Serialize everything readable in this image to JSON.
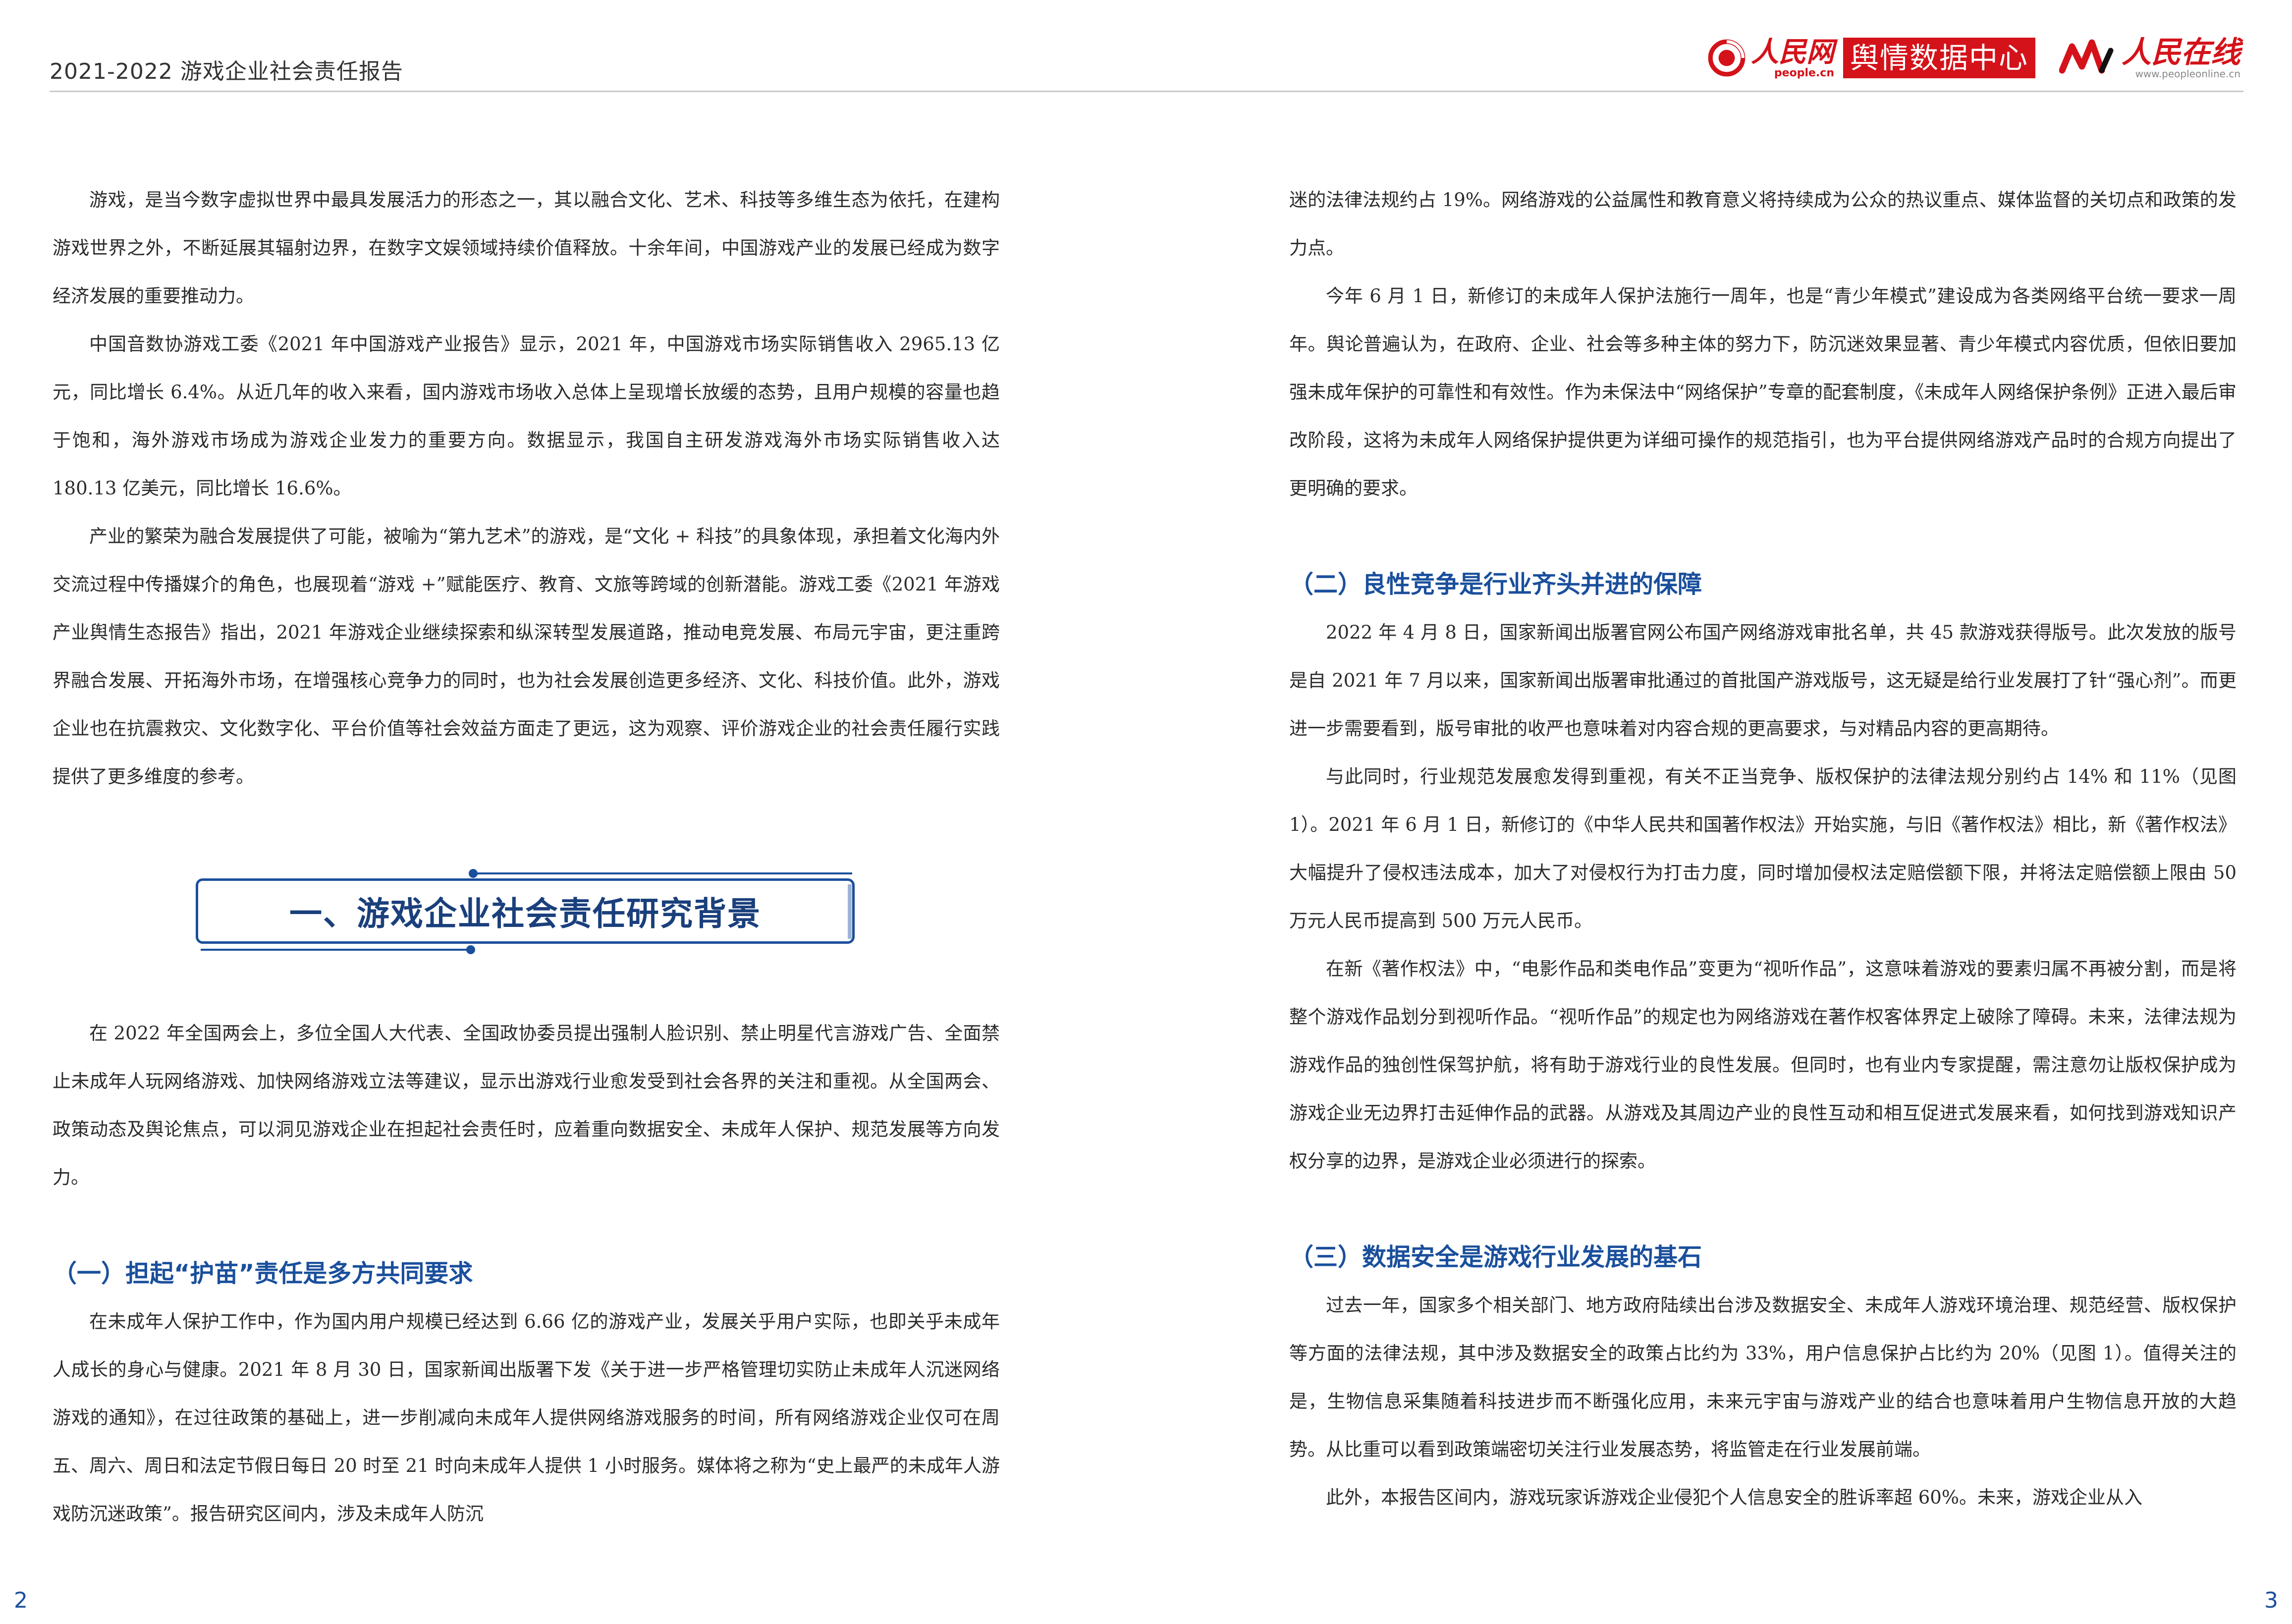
{
  "header": {
    "title": "2021-2022 游戏企业社会责任报告",
    "logo_people_cn": "人民网",
    "logo_people_en": "people.cn",
    "logo_center": "舆情数据中心",
    "logo_online_cn": "人民在线",
    "logo_online_en": "www.peopleonline.cn"
  },
  "left": {
    "p1": "游戏，是当今数字虚拟世界中最具发展活力的形态之一，其以融合文化、艺术、科技等多维生态为依托，在建构游戏世界之外，不断延展其辐射边界，在数字文娱领域持续价值释放。十余年间，中国游戏产业的发展已经成为数字经济发展的重要推动力。",
    "p2": "中国音数协游戏工委《2021 年中国游戏产业报告》显示，2021 年，中国游戏市场实际销售收入 2965.13 亿元，同比增长 6.4%。从近几年的收入来看，国内游戏市场收入总体上呈现增长放缓的态势，且用户规模的容量也趋于饱和，海外游戏市场成为游戏企业发力的重要方向。数据显示，我国自主研发游戏海外市场实际销售收入达 180.13 亿美元，同比增长 16.6%。",
    "p3": "产业的繁荣为融合发展提供了可能，被喻为“第九艺术”的游戏，是“文化 + 科技”的具象体现，承担着文化海内外交流过程中传播媒介的角色，也展现着“游戏 +”赋能医疗、教育、文旅等跨域的创新潜能。游戏工委《2021 年游戏产业舆情生态报告》指出，2021 年游戏企业继续探索和纵深转型发展道路，推动电竞发展、布局元宇宙，更注重跨界融合发展、开拓海外市场，在增强核心竞争力的同时，也为社会发展创造更多经济、文化、科技价值。此外，游戏企业也在抗震救灾、文化数字化、平台价值等社会效益方面走了更远，这为观察、评价游戏企业的社会责任履行实践提供了更多维度的参考。",
    "banner": "一、游戏企业社会责任研究背景",
    "p4": "在 2022 年全国两会上，多位全国人大代表、全国政协委员提出强制人脸识别、禁止明星代言游戏广告、全面禁止未成年人玩网络游戏、加快网络游戏立法等建议，显示出游戏行业愈发受到社会各界的关注和重视。从全国两会、政策动态及舆论焦点，可以洞见游戏企业在担起社会责任时，应着重向数据安全、未成年人保护、规范发展等方向发力。",
    "h1": "（一）担起“护苗”责任是多方共同要求",
    "p5": "在未成年人保护工作中，作为国内用户规模已经达到 6.66 亿的游戏产业，发展关乎用户实际，也即关乎未成年人成长的身心与健康。2021 年 8 月 30 日，国家新闻出版署下发《关于进一步严格管理切实防止未成年人沉迷网络游戏的通知》，在过往政策的基础上，进一步削减向未成年人提供网络游戏服务的时间，所有网络游戏企业仅可在周五、周六、周日和法定节假日每日 20 时至 21 时向未成年人提供 1 小时服务。媒体将之称为“史上最严的未成年人游戏防沉迷政策”。报告研究区间内，涉及未成年人防沉"
  },
  "right": {
    "p1": "迷的法律法规约占 19%。网络游戏的公益属性和教育意义将持续成为公众的热议重点、媒体监督的关切点和政策的发力点。",
    "p2": "今年 6 月 1 日，新修订的未成年人保护法施行一周年，也是“青少年模式”建设成为各类网络平台统一要求一周年。舆论普遍认为，在政府、企业、社会等多种主体的努力下，防沉迷效果显著、青少年模式内容优质，但依旧要加强未成年保护的可靠性和有效性。作为未保法中“网络保护”专章的配套制度，《未成年人网络保护条例》正进入最后审改阶段，这将为未成年人网络保护提供更为详细可操作的规范指引，也为平台提供网络游戏产品时的合规方向提出了更明确的要求。",
    "h2": "（二）良性竞争是行业齐头并进的保障",
    "p3": "2022 年 4 月 8 日，国家新闻出版署官网公布国产网络游戏审批名单，共 45 款游戏获得版号。此次发放的版号是自 2021 年 7 月以来，国家新闻出版署审批通过的首批国产游戏版号，这无疑是给行业发展打了针“强心剂”。而更进一步需要看到，版号审批的收严也意味着对内容合规的更高要求，与对精品内容的更高期待。",
    "p4": "与此同时，行业规范发展愈发得到重视，有关不正当竞争、版权保护的法律法规分别约占 14% 和 11%（见图 1）。2021 年 6 月 1 日，新修订的《中华人民共和国著作权法》开始实施，与旧《著作权法》相比，新《著作权法》大幅提升了侵权违法成本，加大了对侵权行为打击力度，同时增加侵权法定赔偿额下限，并将法定赔偿额上限由 50 万元人民币提高到 500 万元人民币。",
    "p5": "在新《著作权法》中，“电影作品和类电作品”变更为“视听作品”，这意味着游戏的要素归属不再被分割，而是将整个游戏作品划分到视听作品。“视听作品”的规定也为网络游戏在著作权客体界定上破除了障碍。未来，法律法规为游戏作品的独创性保驾护航，将有助于游戏行业的良性发展。但同时，也有业内专家提醒，需注意勿让版权保护成为游戏企业无边界打击延伸作品的武器。从游戏及其周边产业的良性互动和相互促进式发展来看，如何找到游戏知识产权分享的边界，是游戏企业必须进行的探索。",
    "h3": "（三）数据安全是游戏行业发展的基石",
    "p6": "过去一年，国家多个相关部门、地方政府陆续出台涉及数据安全、未成年人游戏环境治理、规范经营、版权保护等方面的法律法规，其中涉及数据安全的政策占比约为 33%，用户信息保护占比约为 20%（见图 1）。值得关注的是，生物信息采集随着科技进步而不断强化应用，未来元宇宙与游戏产业的结合也意味着用户生物信息开放的大趋势。从比重可以看到政策端密切关注行业发展态势，将监管走在行业发展前端。",
    "p7": "此外，本报告区间内，游戏玩家诉游戏企业侵犯个人信息安全的胜诉率超 60%。未来，游戏企业从入"
  },
  "page_numbers": {
    "left": "2",
    "right": "3"
  },
  "colors": {
    "accent_blue": "#1a4f9c",
    "brand_red": "#d4121a"
  }
}
